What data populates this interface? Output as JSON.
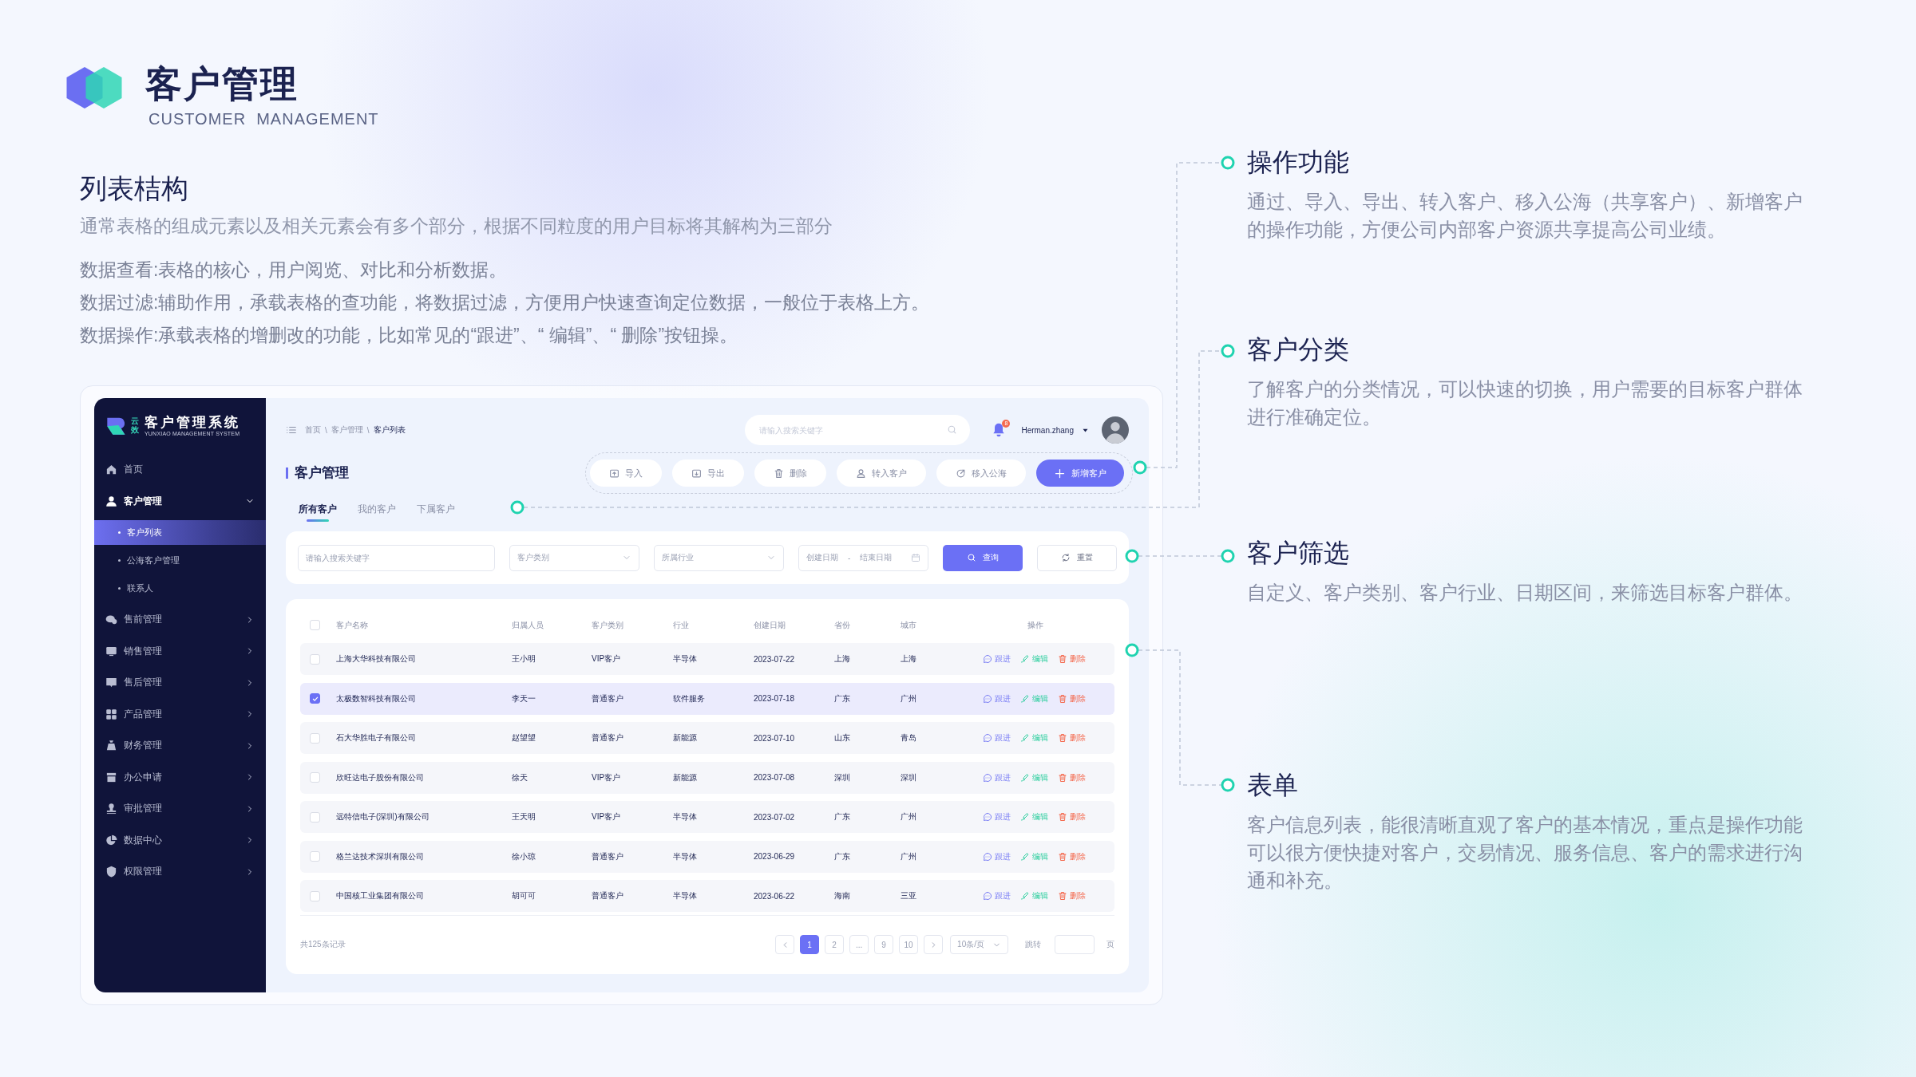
{
  "header": {
    "title": "客户管理",
    "subtitle": "CUSTOMER  MANAGEMENT"
  },
  "intro": {
    "heading": "列表桔构",
    "lines": [
      "通常表格的组成元素以及相关元素会有多个部分，根据不同粒度的用户目标将其解构为三部分",
      "数据查看:表格的核心，用户阅览、对比和分析数据。",
      "数据过滤:辅助作用，承载表格的查功能，将数据过滤，方便用户快速查询定位数据，一般位于表格上方。",
      "数据操作:承载表格的增删改的功能，比如常见的“跟进”、“ 编辑”、“ 删除”按钮操。"
    ]
  },
  "app": {
    "logo": {
      "mark": "云效",
      "name": "客户管理系统",
      "tagline": "YUNXIAO MANAGEMENT SYSTEM"
    },
    "nav": [
      {
        "label": "首页"
      },
      {
        "label": "客户管理",
        "expanded": true,
        "children": [
          {
            "label": "客户列表",
            "selected": true
          },
          {
            "label": "公海客户管理",
            "selected": false
          },
          {
            "label": "联系人",
            "selected": false
          }
        ]
      },
      {
        "label": "售前管理",
        "expanded": false
      },
      {
        "label": "销售管理",
        "expanded": false
      },
      {
        "label": "售后管理",
        "expanded": false
      },
      {
        "label": "产品管理",
        "expanded": false
      },
      {
        "label": "财务管理",
        "expanded": false
      },
      {
        "label": "办公申请",
        "expanded": false
      },
      {
        "label": "审批管理",
        "expanded": false
      },
      {
        "label": "数据中心",
        "expanded": false
      },
      {
        "label": "权限管理",
        "expanded": false
      }
    ],
    "breadcrumb": [
      "首页",
      "客户管理",
      "客户列表"
    ],
    "breadcrumb_separator": "\\",
    "search": {
      "placeholder": "请输入搜索关键字"
    },
    "notification_count": "8",
    "user": "Herman.zhang",
    "page_title": "客户管理",
    "actions": [
      {
        "kind": "import",
        "label": "导入",
        "primary": false
      },
      {
        "kind": "export",
        "label": "导出",
        "primary": false
      },
      {
        "kind": "delete",
        "label": "删除",
        "primary": false
      },
      {
        "kind": "transfer",
        "label": "转入客户",
        "primary": false
      },
      {
        "kind": "move",
        "label": "移入公海",
        "primary": false
      },
      {
        "kind": "add",
        "label": "新增客户",
        "primary": true
      }
    ],
    "tabs": [
      {
        "label": "所有客户",
        "selected": true
      },
      {
        "label": "我的客户",
        "selected": false
      },
      {
        "label": "下属客户",
        "selected": false
      }
    ],
    "filters": {
      "keyword": {
        "placeholder": "请输入搜索关键字"
      },
      "category": {
        "placeholder": "客户类别"
      },
      "industry": {
        "placeholder": "所属行业"
      },
      "date_start": {
        "placeholder": "创建日期"
      },
      "date_separator": "-",
      "date_end": {
        "placeholder": "结束日期"
      },
      "query": "查询",
      "reset": "重置"
    },
    "table": {
      "select_all": {
        "checked": false
      },
      "columns": [
        "客户名称",
        "归属人员",
        "客户类别",
        "行业",
        "创建日期",
        "省份",
        "城市",
        "操作"
      ],
      "rows": [
        {
          "cells": [
            "上海大华科技有限公司",
            "王小明",
            "VIP客户",
            "半导体",
            "2023-07-22",
            "上海",
            "上海"
          ],
          "selected": false,
          "actions": [
            {
              "kind": "follow",
              "label": "跟进"
            },
            {
              "kind": "edit",
              "label": "编辑"
            },
            {
              "kind": "delete",
              "label": "删除"
            }
          ]
        },
        {
          "cells": [
            "太极数智科技有限公司",
            "李天一",
            "普通客户",
            "软件服务",
            "2023-07-18",
            "广东",
            "广州"
          ],
          "selected": true,
          "actions": [
            {
              "kind": "follow",
              "label": "跟进"
            },
            {
              "kind": "edit",
              "label": "编辑"
            },
            {
              "kind": "delete",
              "label": "删除"
            }
          ]
        },
        {
          "cells": [
            "石大华胜电子有限公司",
            "赵望望",
            "普通客户",
            "新能源",
            "2023-07-10",
            "山东",
            "青岛"
          ],
          "selected": false,
          "actions": [
            {
              "kind": "follow",
              "label": "跟进"
            },
            {
              "kind": "edit",
              "label": "编辑"
            },
            {
              "kind": "delete",
              "label": "删除"
            }
          ]
        },
        {
          "cells": [
            "欣旺达电子股份有限公司",
            "徐天",
            "VIP客户",
            "新能源",
            "2023-07-08",
            "深圳",
            "深圳"
          ],
          "selected": false,
          "actions": [
            {
              "kind": "follow",
              "label": "跟进"
            },
            {
              "kind": "edit",
              "label": "编辑"
            },
            {
              "kind": "delete",
              "label": "删除"
            }
          ]
        },
        {
          "cells": [
            "远特信电子(深圳)有限公司",
            "王天明",
            "VIP客户",
            "半导体",
            "2023-07-02",
            "广东",
            "广州"
          ],
          "selected": false,
          "actions": [
            {
              "kind": "follow",
              "label": "跟进"
            },
            {
              "kind": "edit",
              "label": "编辑"
            },
            {
              "kind": "delete",
              "label": "删除"
            }
          ]
        },
        {
          "cells": [
            "格兰达技术深圳有限公司",
            "徐小琼",
            "普通客户",
            "半导体",
            "2023-06-29",
            "广东",
            "广州"
          ],
          "selected": false,
          "actions": [
            {
              "kind": "follow",
              "label": "跟进"
            },
            {
              "kind": "edit",
              "label": "编辑"
            },
            {
              "kind": "delete",
              "label": "删除"
            }
          ]
        },
        {
          "cells": [
            "中国核工业集团有限公司",
            "胡可可",
            "普通客户",
            "半导体",
            "2023-06-22",
            "海南",
            "三亚"
          ],
          "selected": false,
          "actions": [
            {
              "kind": "follow",
              "label": "跟进"
            },
            {
              "kind": "edit",
              "label": "编辑"
            },
            {
              "kind": "delete",
              "label": "删除"
            }
          ]
        }
      ]
    },
    "footer": {
      "total": "共125条记录",
      "pages": [
        {
          "label": "1",
          "selected": true
        },
        {
          "label": "2",
          "selected": false
        },
        {
          "label": "...",
          "selected": false
        },
        {
          "label": "9",
          "selected": false
        },
        {
          "label": "10",
          "selected": false
        }
      ],
      "page_size": "10条/页",
      "jump": "跳转",
      "page_unit": "页"
    }
  },
  "notes": [
    {
      "title": "操作功能",
      "text": "通过、导入、导出、转入客户、移入公海（共享客户）、新增客户的操作功能，方便公司内部客户资源共享提高公司业绩。"
    },
    {
      "title": "客户分类",
      "text": "了解客户的分类情况，可以快速的切换，用户需要的目标客户群体进行准确定位。"
    },
    {
      "title": "客户筛选",
      "text": "自定义、客户类别、客户行业、日期区间，来筛选目标客户群体。"
    },
    {
      "title": "表单",
      "text": "客户信息列表，能很清晰直观了客户的基本情况，重点是操作功能可以很方便快捷对客户，交易情况、服务信息、客户的需求进行沟通和补充。"
    }
  ]
}
